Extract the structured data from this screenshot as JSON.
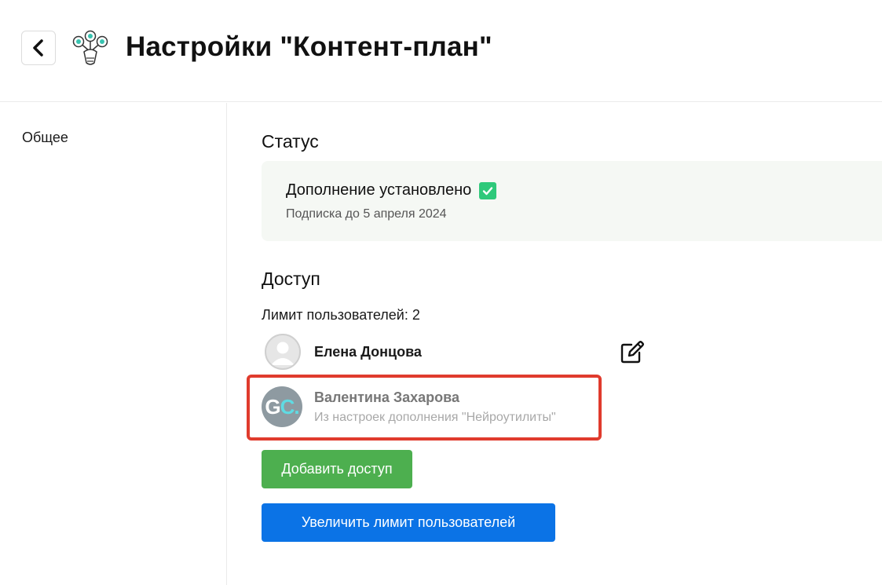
{
  "header": {
    "title": "Настройки \"Контент-план\"",
    "back_icon": "chevron-left-icon",
    "logo_icon": "addon-logo-icon"
  },
  "sidebar": {
    "items": [
      {
        "label": "Общее"
      }
    ]
  },
  "status": {
    "title": "Статус",
    "installed_label": "Дополнение установлено",
    "subscription_text": "Подписка до 5 апреля 2024",
    "check_color": "#2ec97a"
  },
  "access": {
    "title": "Доступ",
    "limit_text": "Лимит пользователей: 2",
    "users": [
      {
        "name": "Елена Донцова",
        "avatar_icon": "default-avatar-icon",
        "edit_icon": "edit-icon"
      },
      {
        "name": "Валентина Захарова",
        "initials_1": "G",
        "initials_2": "C.",
        "source": "Из настроек дополнения \"Нейроутилиты\""
      }
    ],
    "add_button": "Добавить доступ",
    "increase_button": "Увеличить лимит пользователей"
  },
  "colors": {
    "green_button": "#4daf4f",
    "blue_button": "#0b73e6",
    "highlight_border": "#e03b2d"
  }
}
